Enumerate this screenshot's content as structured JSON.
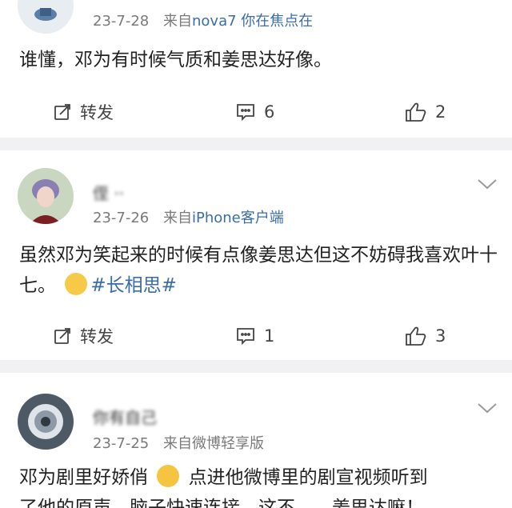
{
  "posts": [
    {
      "time": "23-7-28",
      "source_prefix": "来自",
      "device": "nova7 你在焦点在",
      "text": "谁懂，邓为有时候气质和姜思达好像。",
      "repost_label": "转发",
      "comments": "6",
      "likes": "2"
    },
    {
      "username": "侄 ··",
      "time": "23-7-26",
      "source_prefix": "来自",
      "device": "iPhone客户端",
      "text": "虽然邓为笑起来的时候有点像姜思达但这不妨碍我喜欢叶十七。",
      "hashtag": "#长相思#",
      "repost_label": "转发",
      "comments": "1",
      "likes": "3"
    },
    {
      "username": "你有自己",
      "time": "23-7-25",
      "source_prefix": "来自",
      "device": "微博轻享版",
      "text_a": "邓为剧里好娇俏",
      "text_b": "点进他微博里的剧宣视频听到",
      "text_c": "了他的原声，脑子快速连接，这不……姜思达嘛！"
    }
  ],
  "colors": {
    "link": "#3a6da8",
    "meta": "#7a7a7a",
    "separator": "#f1f1f3"
  }
}
